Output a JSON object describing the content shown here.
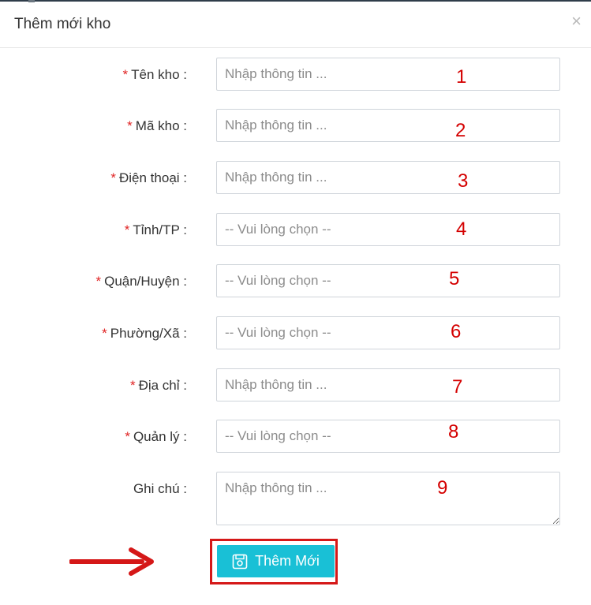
{
  "modal": {
    "title": "Thêm mới kho",
    "close_label": "×"
  },
  "form": {
    "required_mark": "*",
    "fields": [
      {
        "label": "Tên kho :",
        "placeholder": "Nhập thông tin ...",
        "annotation": "1",
        "required": true
      },
      {
        "label": "Mã kho :",
        "placeholder": "Nhập thông tin ...",
        "annotation": "2",
        "required": true
      },
      {
        "label": "Điện thoại :",
        "placeholder": "Nhập thông tin ...",
        "annotation": "3",
        "required": true
      },
      {
        "label": "Tỉnh/TP :",
        "selected": "-- Vui lòng chọn --",
        "annotation": "4",
        "required": true
      },
      {
        "label": "Quận/Huyện :",
        "selected": "-- Vui lòng chọn --",
        "annotation": "5",
        "required": true
      },
      {
        "label": "Phường/Xã :",
        "selected": "-- Vui lòng chọn --",
        "annotation": "6",
        "required": true
      },
      {
        "label": "Địa chỉ :",
        "placeholder": "Nhập thông tin ...",
        "annotation": "7",
        "required": true
      },
      {
        "label": "Quản lý :",
        "selected": "-- Vui lòng chọn --",
        "annotation": "8",
        "required": true
      },
      {
        "label": "Ghi chú :",
        "placeholder": "Nhập thông tin ...",
        "annotation": "9",
        "required": false
      }
    ],
    "submit_label": "Thêm Mới",
    "submit_icon": "save-icon"
  },
  "colors": {
    "accent": "#19c0d6",
    "required": "#e02424",
    "annotation": "#d40000"
  }
}
